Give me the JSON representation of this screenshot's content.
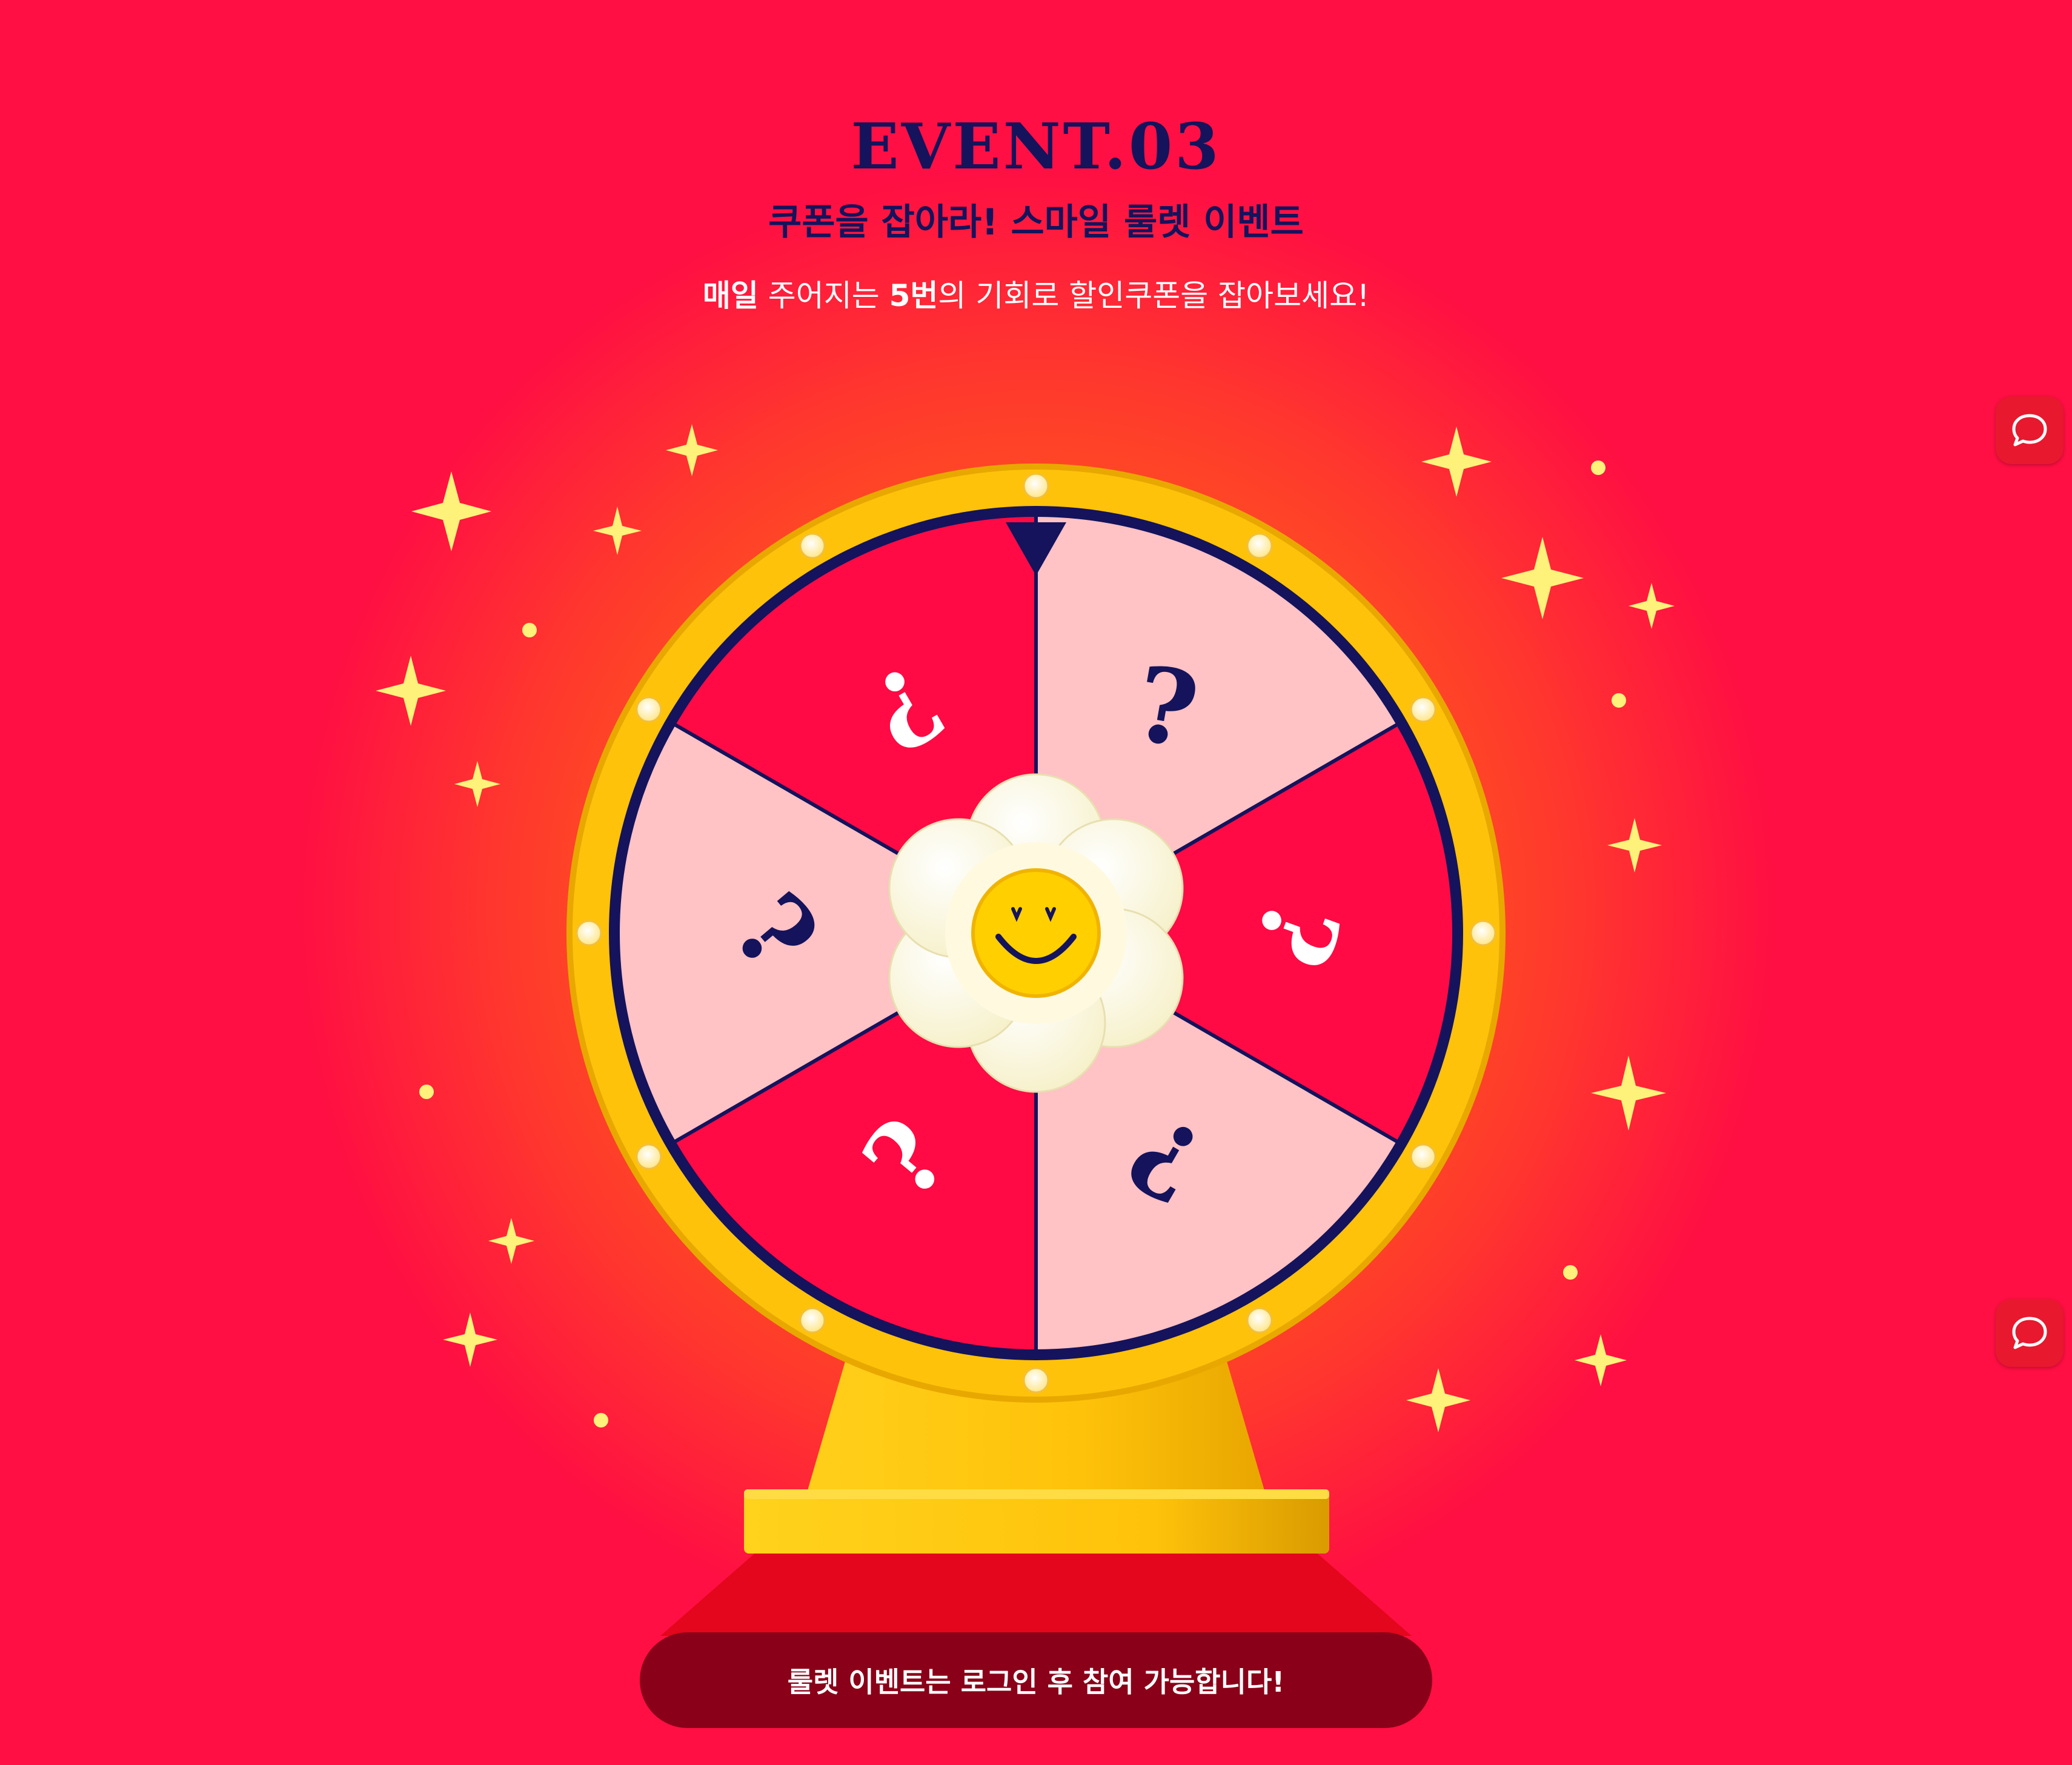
{
  "event": {
    "title": "EVENT.03",
    "subtitle": "쿠폰을 잡아라! 스마일 룰렛 이벤트",
    "description": {
      "part1": "매일",
      "part2": " 주어지는 ",
      "part3": "5번",
      "part4": "의 기회로 할인쿠폰을 잡아보세요!"
    }
  },
  "wheel": {
    "segments": [
      {
        "label": "?",
        "color": "#ffc2c5"
      },
      {
        "label": "?",
        "color": "#ff0a44"
      },
      {
        "label": "?",
        "color": "#ffc2c5"
      },
      {
        "label": "?",
        "color": "#ff0a44"
      },
      {
        "label": "?",
        "color": "#ffc2c5"
      },
      {
        "label": "?",
        "color": "#ff0a44"
      }
    ],
    "pointer": "pointer-triangle-icon",
    "center": "smiley-flower-icon"
  },
  "login_notice": "룰렛 이벤트는 로그인 후 참여 가능합니다!",
  "side_buttons": [
    {
      "icon": "chat-bubble-icon"
    },
    {
      "icon": "chat-bubble-icon"
    }
  ],
  "colors": {
    "background": "#ff0f43",
    "glow": "#ff6a16",
    "navy": "#14135c",
    "gold": "#ffc20a",
    "pink": "#ffc2c5",
    "red": "#ff0a44",
    "notice_bar": "#8a0018"
  }
}
